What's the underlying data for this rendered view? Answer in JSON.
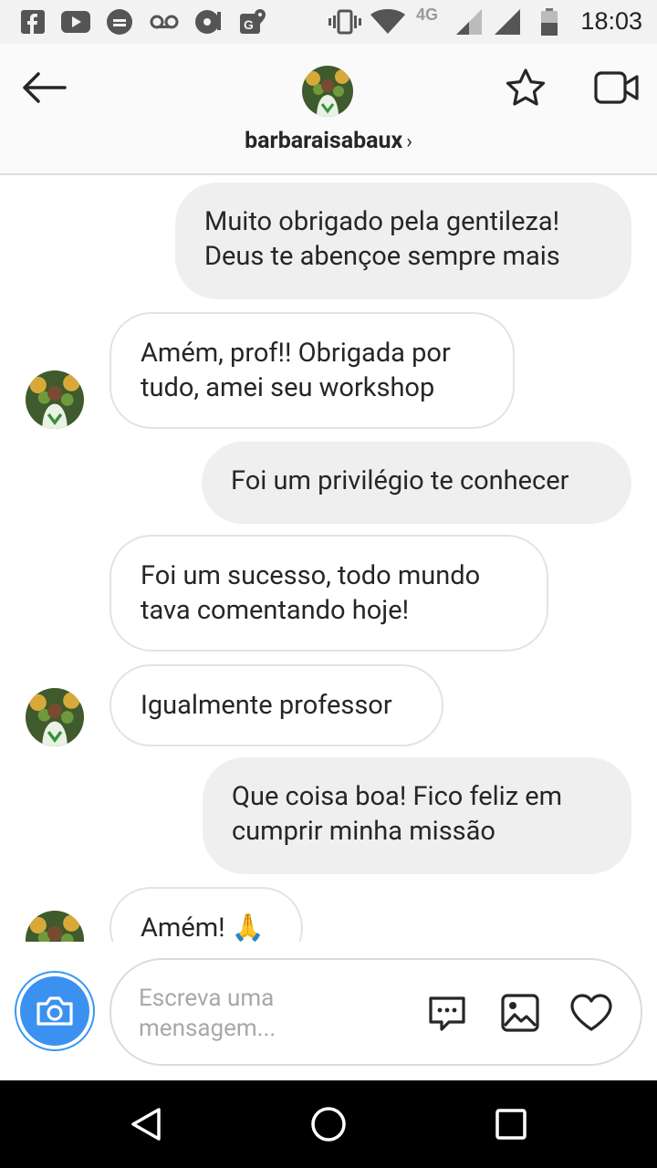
{
  "status_bar": {
    "time": "18:03",
    "network": "4G",
    "icons": [
      "facebook-icon",
      "youtube-icon",
      "download-icon",
      "voicemail-icon",
      "media-icon",
      "maps-icon",
      "vibrate-icon",
      "wifi-icon",
      "signal-icon",
      "signal-icon-2",
      "battery-icon"
    ]
  },
  "header": {
    "username": "barbaraisabaux",
    "chevron": "›",
    "icons": [
      "back-arrow-icon",
      "star-icon",
      "video-call-icon"
    ]
  },
  "messages": [
    {
      "sender": "me",
      "text_lines": [
        "Muito obrigado pela gentileza!",
        "Deus te abençoe sempre mais"
      ]
    },
    {
      "sender": "them",
      "text_lines": [
        "Amém, prof!! Obrigada por",
        "tudo, amei seu workshop"
      ]
    },
    {
      "sender": "me",
      "text_lines": [
        "Foi um privilégio te conhecer"
      ]
    },
    {
      "sender": "them",
      "text_lines": [
        "Foi um sucesso, todo mundo",
        "tava comentando hoje!"
      ]
    },
    {
      "sender": "them",
      "text_lines": [
        "Igualmente professor"
      ]
    },
    {
      "sender": "me",
      "text_lines": [
        "Que coisa boa! Fico feliz em",
        "cumprir minha missão"
      ]
    },
    {
      "sender": "them",
      "text_lines": [
        "Amém! 🙏"
      ]
    }
  ],
  "composer": {
    "placeholder_lines": [
      "Escreva uma",
      "mensagem..."
    ],
    "icons": [
      "camera-icon",
      "chat-options-icon",
      "gallery-icon",
      "heart-icon"
    ]
  },
  "colors": {
    "accent_blue": "#3897f0",
    "sent_bubble": "#efefef",
    "received_border": "#e3e3e3"
  }
}
